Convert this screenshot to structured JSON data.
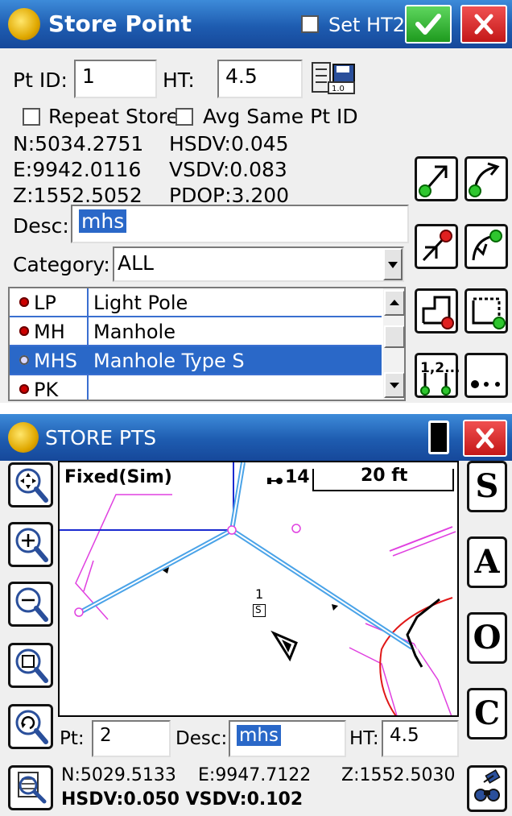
{
  "store_point": {
    "title": "Store Point",
    "set_ht2_label": "Set HT2",
    "pt_id_label": "Pt ID:",
    "pt_id_value": "1",
    "ht_label": "HT:",
    "ht_value": "4.5",
    "repeat_store_label": "Repeat Store",
    "avg_same_label": "Avg Same Pt ID",
    "n": "N:5034.2751",
    "e": "E:9942.0116",
    "z": "Z:1552.5052",
    "hsdv": "HSDV:0.045",
    "vsdv": "VSDV:0.083",
    "pdop": "PDOP:3.200",
    "desc_label": "Desc:",
    "desc_value": "mhs",
    "category_label": "Category:",
    "category_value": "ALL",
    "list": [
      {
        "code": "LP",
        "name": "Light Pole"
      },
      {
        "code": "MH",
        "name": "Manhole"
      },
      {
        "code": "MHS",
        "name": "Manhole Type S"
      },
      {
        "code": "PK",
        "name": ""
      }
    ],
    "seq_label": "1,2..."
  },
  "store_pts": {
    "title": "STORE PTS",
    "fix_status": "Fixed(Sim)",
    "sat_count": "14",
    "scale_label": "20 ft",
    "point_label": "1",
    "point_code": "S",
    "pt_label": "Pt:",
    "pt_value": "2",
    "desc_label": "Desc:",
    "desc_value": "mhs",
    "ht_label": "HT:",
    "ht_value": "4.5",
    "n": "N:5029.5133",
    "e": "E:9947.7122",
    "z": "Z:1552.5030",
    "std": "HSDV:0.050 VSDV:0.102",
    "side_buttons": [
      "S",
      "A",
      "O",
      "C"
    ]
  },
  "colors": {
    "titlebar": "#1e5cb0",
    "selection": "#2a68c8",
    "ok_green": "#1e9a1e",
    "close_red": "#c41818"
  }
}
